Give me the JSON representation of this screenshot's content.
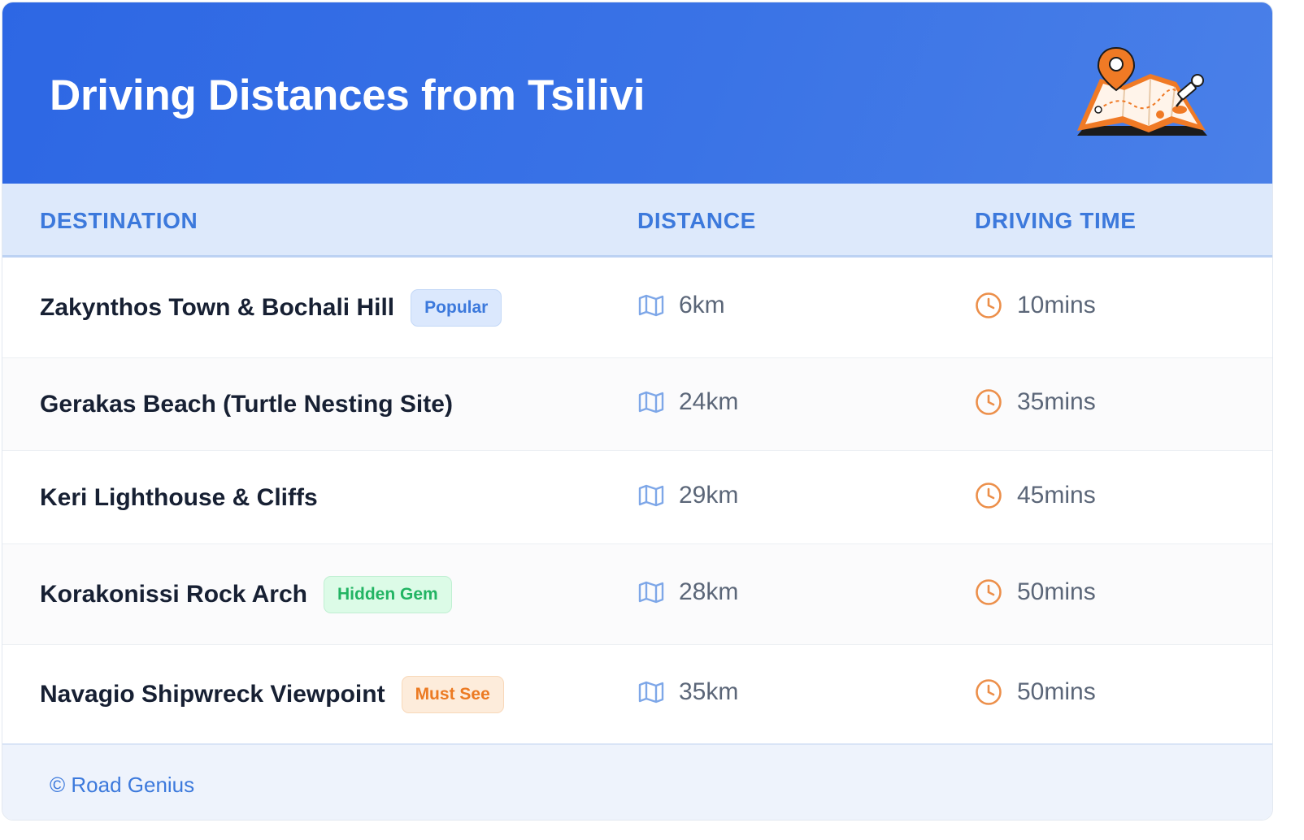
{
  "title": "Driving Distances from Tsilivi",
  "illustration": "map-pin-illustration",
  "columns": {
    "destination": "DESTINATION",
    "distance": "DISTANCE",
    "time": "DRIVING TIME"
  },
  "rows": [
    {
      "destination": "Zakynthos Town & Bochali Hill",
      "badge": "Popular",
      "badge_color": "#3c79dc",
      "distance": "6km",
      "time": "10mins"
    },
    {
      "destination": "Gerakas Beach (Turtle Nesting Site)",
      "badge": "",
      "distance": "24km",
      "time": "35mins"
    },
    {
      "destination": "Keri Lighthouse & Cliffs",
      "badge": "",
      "distance": "29km",
      "time": "45mins"
    },
    {
      "destination": "Korakonissi Rock Arch",
      "badge": "Hidden Gem",
      "badge_color": "#22b463",
      "distance": "28km",
      "time": "50mins"
    },
    {
      "destination": "Navagio Shipwreck Viewpoint",
      "badge": "Must See",
      "badge_color": "#ec7a22",
      "distance": "35km",
      "time": "50mins"
    }
  ],
  "icons": {
    "distance": "map-icon",
    "time": "clock-icon"
  },
  "footer": "© Road Genius",
  "colors": {
    "header": "#2d67e4",
    "accent": "#3c79dc",
    "clock": "#ec7a22"
  }
}
